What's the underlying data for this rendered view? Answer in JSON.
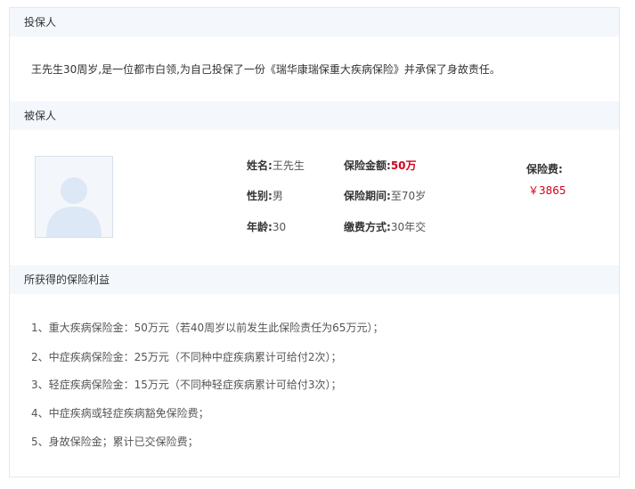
{
  "sections": {
    "policyholder_title": "投保人",
    "insured_title": "被保人",
    "benefits_title": "所获得的保险利益"
  },
  "policyholder": {
    "description": "王先生30周岁,是一位都市白领,为自己投保了一份《瑞华康瑞保重大疾病保险》并承保了身故责任。"
  },
  "insured": {
    "name_label": "姓名:",
    "name_value": "王先生",
    "gender_label": "性别:",
    "gender_value": "男",
    "age_label": "年龄:",
    "age_value": "30",
    "amount_label": "保险金额:",
    "amount_value": "50万",
    "period_label": "保险期间:",
    "period_value": "至70岁",
    "payment_label": "缴费方式:",
    "payment_value": "30年交",
    "premium_label": "保险费:",
    "premium_value": "￥3865",
    "avatar_icon": "user-silhouette-icon"
  },
  "benefits": [
    "1、重大疾病保险金：50万元（若40周岁以前发生此保险责任为65万元）；",
    "2、中症疾病保险金：25万元（不同种中症疾病累计可给付2次）；",
    "3、轻症疾病保险金：15万元（不同种轻症疾病累计可给付3次）；",
    "4、中症疾病或轻症疾病豁免保险费；",
    "5、身故保险金；累计已交保险费；"
  ],
  "colors": {
    "header_bg": "#f4f7fc",
    "border": "#e3e8ee",
    "accent_red": "#d0021b"
  }
}
